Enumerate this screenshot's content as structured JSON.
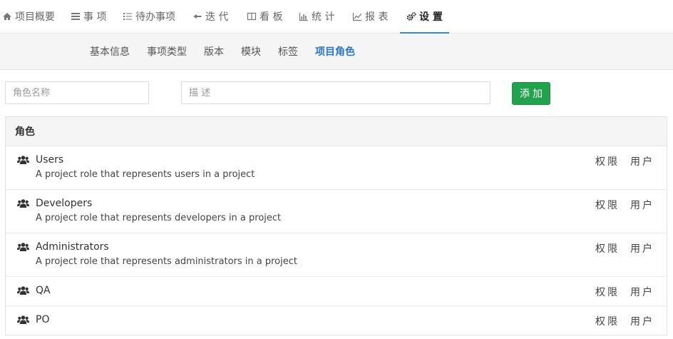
{
  "topnav": {
    "tabs": [
      {
        "label": "项目概要",
        "icon": "home-icon"
      },
      {
        "label": "事 项",
        "icon": "list-icon"
      },
      {
        "label": "待办事项",
        "icon": "checklist-icon"
      },
      {
        "label": "迭 代",
        "icon": "sprint-icon"
      },
      {
        "label": "看 板",
        "icon": "board-icon"
      },
      {
        "label": "统 计",
        "icon": "bar-chart-icon"
      },
      {
        "label": "报 表",
        "icon": "line-chart-icon"
      },
      {
        "label": "设 置",
        "icon": "gears-icon"
      }
    ],
    "active_tab": "设 置"
  },
  "subnav": {
    "items": [
      "基本信息",
      "事项类型",
      "版本",
      "模块",
      "标签",
      "项目角色"
    ],
    "active_item": "项目角色"
  },
  "form": {
    "role_name_placeholder": "角色名称",
    "description_placeholder": "描 述",
    "add_label": "添加"
  },
  "roles_table": {
    "header": "角色",
    "permission_label": "权限",
    "users_label": "用户",
    "rows": [
      {
        "name": "Users",
        "description": "A project role that represents users in a project"
      },
      {
        "name": "Developers",
        "description": "A project role that represents developers in a project"
      },
      {
        "name": "Administrators",
        "description": "A project role that represents administrators in a project"
      },
      {
        "name": "QA",
        "description": ""
      },
      {
        "name": "PO",
        "description": ""
      }
    ]
  },
  "colors": {
    "accent": "#3a87d6",
    "active_subnav": "#2a76c6",
    "add_button": "#23a24d"
  }
}
